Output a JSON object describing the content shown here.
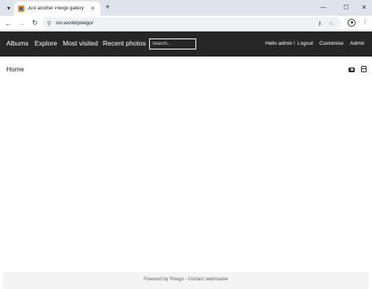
{
  "browser": {
    "tab_title": "Just another Piwigo gallery",
    "url": "srv.world/piwigo/"
  },
  "site_nav": {
    "links": [
      "Albums",
      "Explore",
      "Most visited",
      "Recent photos"
    ],
    "search_placeholder": "Search...",
    "greeting": "Hello admin !",
    "logout": "Logout",
    "customise": "Customise",
    "admin": "Admin"
  },
  "page": {
    "title": "Home"
  },
  "footer": {
    "powered_by": "Powered by",
    "piwigo": "Piwigo",
    "separator": " - ",
    "contact": "Contact webmaster"
  },
  "colors": {
    "header_bg": "#262626",
    "tabstrip_bg": "#dfe3eb"
  }
}
